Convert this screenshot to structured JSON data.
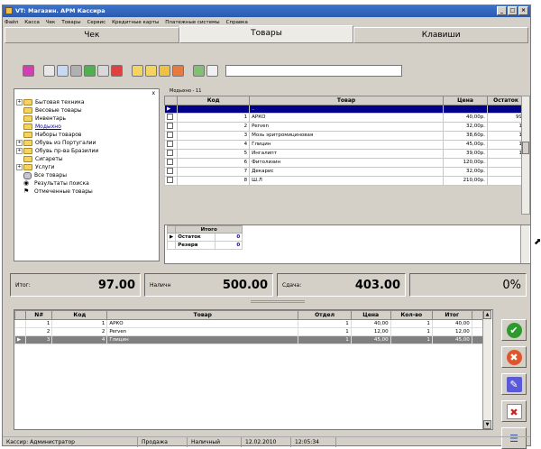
{
  "window": {
    "title": "VT: Магазин. АРМ Кассира",
    "controls": [
      "_",
      "□",
      "×"
    ]
  },
  "menu": [
    "Файл",
    "Касса",
    "Чек",
    "Товары",
    "Сервис",
    "Кредитные карты",
    "Платежные системы",
    "Справка"
  ],
  "tabs": [
    "Чек",
    "Товары",
    "Клавиши"
  ],
  "active_tab": 1,
  "toolbar": {
    "search_value": "",
    "icons": [
      "pink-icon",
      "print-icon",
      "copy-icon",
      "tools-icon",
      "refresh-icon",
      "print-preview-icon",
      "exit-icon",
      "folder-icon",
      "folder-open-icon",
      "folder-up-icon",
      "folder-red-icon",
      "doc-icon",
      "table-icon"
    ]
  },
  "tree": {
    "header": "x",
    "items": [
      {
        "label": "Бытовая техника",
        "pm": "+",
        "icon": "folder"
      },
      {
        "label": "Весовые товары",
        "pm": "",
        "icon": "folder"
      },
      {
        "label": "Инвентарь",
        "pm": "",
        "icon": "folder"
      },
      {
        "label": "Модыхно",
        "pm": "",
        "icon": "folder",
        "selected": true
      },
      {
        "label": "Наборы товаров",
        "pm": "",
        "icon": "folder"
      },
      {
        "label": "Обувь из Португалии",
        "pm": "+",
        "icon": "folder"
      },
      {
        "label": "Обувь пр-ва Бразилии",
        "pm": "+",
        "icon": "folder"
      },
      {
        "label": "Сигареты",
        "pm": "",
        "icon": "folder"
      },
      {
        "label": "Услуги",
        "pm": "+",
        "icon": "folder"
      },
      {
        "label": "Все товары",
        "pm": "",
        "icon": "db"
      },
      {
        "label": "Результаты поиска",
        "pm": "",
        "icon": "bino"
      },
      {
        "label": "Отмеченные товары",
        "pm": "",
        "icon": "flag"
      }
    ]
  },
  "goods": {
    "caption": "Модыхно - 11",
    "columns": [
      "",
      "Код",
      "Товар",
      "Цена",
      "Остаток"
    ],
    "rows": [
      {
        "code": "",
        "name": "..",
        "price": "",
        "stock": "",
        "current": true
      },
      {
        "code": "1",
        "name": "АРКО",
        "price": "40,00р.",
        "stock": "99"
      },
      {
        "code": "2",
        "name": "Perven",
        "price": "32,00р.",
        "stock": "1"
      },
      {
        "code": "3",
        "name": "Мозь эритромициновая",
        "price": "38,60р.",
        "stock": "1"
      },
      {
        "code": "4",
        "name": "Глицин",
        "price": "45,00р.",
        "stock": "1"
      },
      {
        "code": "5",
        "name": "Ингалипт",
        "price": "39,00р.",
        "stock": "1"
      },
      {
        "code": "6",
        "name": "Фитолизин",
        "price": "120,00р.",
        "stock": ""
      },
      {
        "code": "7",
        "name": "Декарис",
        "price": "32,00р.",
        "stock": ""
      },
      {
        "code": "8",
        "name": "Ш.Л",
        "price": "210,00р.",
        "stock": ""
      }
    ]
  },
  "stock_totals": {
    "header": "Итого",
    "rows": [
      {
        "label": "Остаток",
        "value": "0"
      },
      {
        "label": "Резерв",
        "value": "0"
      }
    ]
  },
  "summary": {
    "total_label": "Итог:",
    "total_value": "97.00",
    "cash_label": "Наличн",
    "cash_value": "500.00",
    "change_label": "Сдача:",
    "change_value": "403.00",
    "percent_value": "0%"
  },
  "cart": {
    "columns": [
      "N#",
      "Код",
      "Товар",
      "Отдел",
      "Цена",
      "Кол-во",
      "Итог",
      ""
    ],
    "rows": [
      {
        "n": "1",
        "code": "1",
        "name": "АРКО",
        "dept": "1",
        "price": "40,00",
        "qty": "1",
        "total": "40,00"
      },
      {
        "n": "2",
        "code": "2",
        "name": "Perven",
        "dept": "1",
        "price": "12,00",
        "qty": "1",
        "total": "12,00"
      },
      {
        "n": "3",
        "code": "4",
        "name": "Глицин",
        "dept": "1",
        "price": "45,00",
        "qty": "1",
        "total": "45,00",
        "selected": true
      }
    ]
  },
  "side_buttons": [
    {
      "name": "confirm-icon",
      "color": "#2e9a2e",
      "glyph": "✔"
    },
    {
      "name": "cancel-icon",
      "color": "#e0552a",
      "glyph": "✖"
    },
    {
      "name": "edit-icon",
      "color": "#5a5ad8",
      "glyph": "✎"
    },
    {
      "name": "delete-icon",
      "color": "#cc2222",
      "glyph": "✖"
    },
    {
      "name": "list-icon",
      "color": "#3050a0",
      "glyph": "☰"
    }
  ],
  "status": {
    "user": "Кассир: Администратор",
    "mode": "Продажа",
    "payment": "Наличный",
    "date": "12.02.2010",
    "time": "12:05:34"
  }
}
